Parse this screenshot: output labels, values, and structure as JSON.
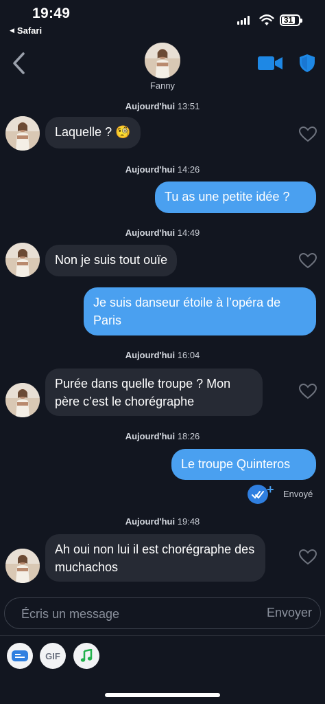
{
  "status_bar": {
    "time": "19:49",
    "back_app": "Safari",
    "battery": "31"
  },
  "header": {
    "name": "Fanny"
  },
  "messages": [
    {
      "ts_day": "Aujourd'hui",
      "ts_time": "13:51",
      "text": "Laquelle ? 🧐"
    },
    {
      "ts_day": "Aujourd'hui",
      "ts_time": "14:26",
      "text": "Tu as une petite idée ?"
    },
    {
      "ts_day": "Aujourd'hui",
      "ts_time": "14:49",
      "text": "Non je suis tout ouïe"
    },
    {
      "text": "Je suis danseur étoile à l’opéra de Paris"
    },
    {
      "ts_day": "Aujourd'hui",
      "ts_time": "16:04",
      "text": "Purée dans quelle troupe ? Mon père c’est le chorégraphe"
    },
    {
      "ts_day": "Aujourd'hui",
      "ts_time": "18:26",
      "text": "Le troupe Quinteros",
      "status": "Envoyé"
    },
    {
      "ts_day": "Aujourd'hui",
      "ts_time": "19:48",
      "text": "Ah oui non lui il est chorégraphe des muchachos"
    }
  ],
  "composer": {
    "placeholder": "Écris un message",
    "send_label": "Envoyer"
  },
  "toolbar": {
    "gif_label": "GIF"
  },
  "colors": {
    "background": "#121620",
    "outgoing": "#4aa0f0",
    "incoming": "#262a34",
    "accent": "#1e88e5"
  }
}
